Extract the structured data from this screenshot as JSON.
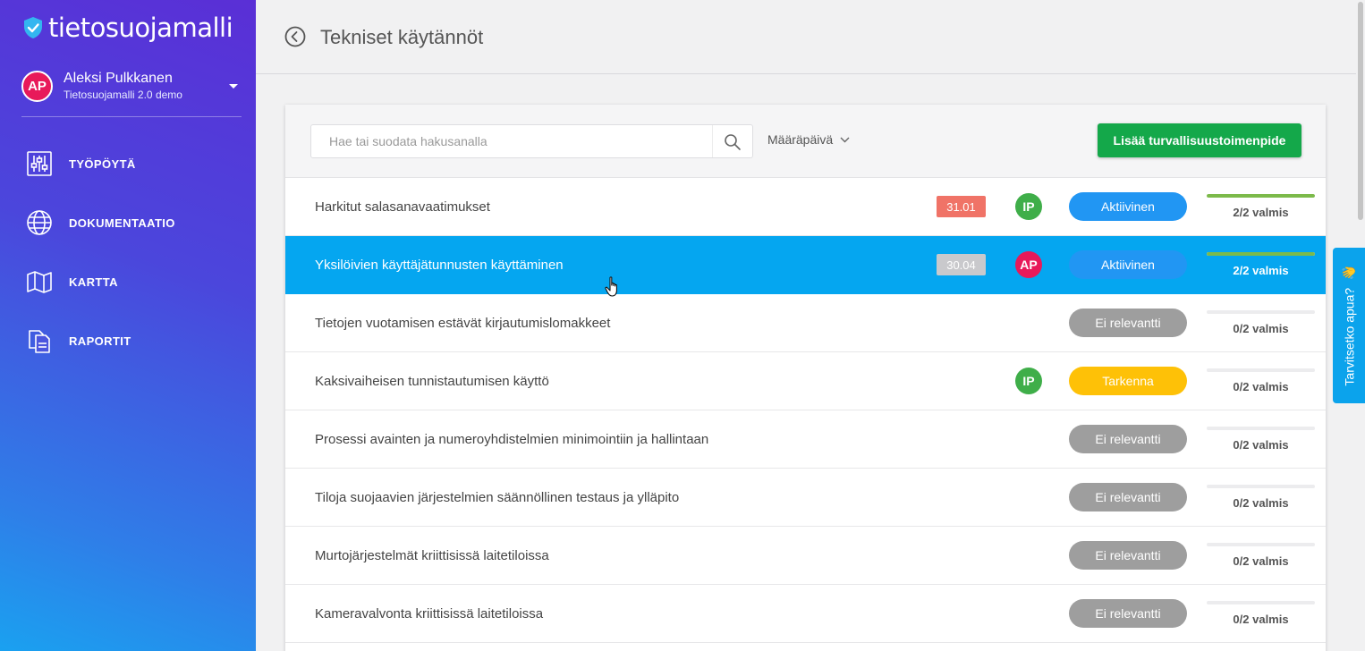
{
  "app": {
    "logo_text": "tietosuojamalli"
  },
  "user": {
    "initials": "AP",
    "name": "Aleksi Pulkkanen",
    "org": "Tietosuojamalli 2.0 demo"
  },
  "nav": [
    {
      "label": "TYÖPÖYTÄ",
      "icon": "sliders-icon"
    },
    {
      "label": "DOKUMENTAATIO",
      "icon": "globe-icon"
    },
    {
      "label": "KARTTA",
      "icon": "map-icon"
    },
    {
      "label": "RAPORTIT",
      "icon": "documents-icon"
    }
  ],
  "header": {
    "title": "Tekniset käytännöt"
  },
  "toolbar": {
    "search_placeholder": "Hae tai suodata hakusanalla",
    "sort_label": "Määräpäivä",
    "add_label": "Lisää turvallisuustoimenpide"
  },
  "rows": [
    {
      "title": "Harkitut salasanavaatimukset",
      "date": "31.01",
      "date_color": "#f07367",
      "assignee": "IP",
      "assignee_color": "#3fae49",
      "status": "Aktiivinen",
      "status_color": "#2196f3",
      "progress": 1.0,
      "progress_label": "2/2 valmis",
      "selected": false
    },
    {
      "title": "Yksilöivien käyttäjätunnusten käyttäminen",
      "date": "30.04",
      "date_color": "#c9c9cc",
      "assignee": "AP",
      "assignee_color": "#e8195a",
      "status": "Aktiivinen",
      "status_color": "#2196f3",
      "progress": 1.0,
      "progress_label": "2/2 valmis",
      "selected": true
    },
    {
      "title": "Tietojen vuotamisen estävät kirjautumislomakkeet",
      "date": "",
      "assignee": "",
      "status": "Ei relevantti",
      "status_color": "#9e9e9e",
      "progress": 0,
      "progress_label": "0/2 valmis",
      "selected": false
    },
    {
      "title": "Kaksivaiheisen tunnistautumisen käyttö",
      "date": "",
      "assignee": "IP",
      "assignee_color": "#3fae49",
      "status": "Tarkenna",
      "status_color": "#fec107",
      "progress": 0,
      "progress_label": "0/2 valmis",
      "selected": false
    },
    {
      "title": "Prosessi avainten ja numeroyhdistelmien minimointiin ja hallintaan",
      "date": "",
      "assignee": "",
      "status": "Ei relevantti",
      "status_color": "#9e9e9e",
      "progress": 0,
      "progress_label": "0/2 valmis",
      "selected": false
    },
    {
      "title": "Tiloja suojaavien järjestelmien säännöllinen testaus ja ylläpito",
      "date": "",
      "assignee": "",
      "status": "Ei relevantti",
      "status_color": "#9e9e9e",
      "progress": 0,
      "progress_label": "0/2 valmis",
      "selected": false
    },
    {
      "title": "Murtojärjestelmät kriittisissä laitetiloissa",
      "date": "",
      "assignee": "",
      "status": "Ei relevantti",
      "status_color": "#9e9e9e",
      "progress": 0,
      "progress_label": "0/2 valmis",
      "selected": false
    },
    {
      "title": "Kameravalvonta kriittisissä laitetiloissa",
      "date": "",
      "assignee": "",
      "status": "Ei relevantti",
      "status_color": "#9e9e9e",
      "progress": 0,
      "progress_label": "0/2 valmis",
      "selected": false
    }
  ],
  "help": {
    "label": "Tarvitsetko apua?",
    "icon": "waving-hand-icon"
  }
}
